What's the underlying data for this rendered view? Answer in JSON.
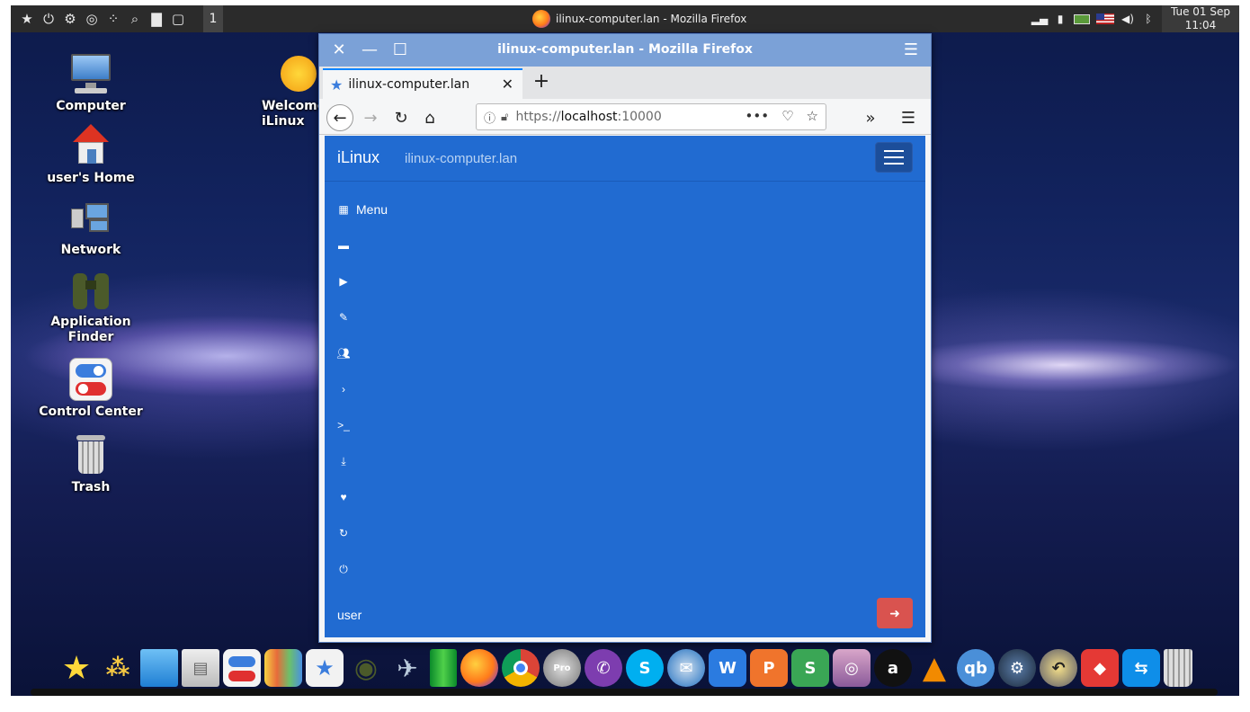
{
  "top_panel": {
    "workspace": "1",
    "task_title": "ilinux-computer.lan - Mozilla Firefox",
    "clock_date": "Tue 01 Sep",
    "clock_time": "11:04",
    "icons": [
      "favorites-star-icon",
      "power-icon",
      "settings-icon",
      "binoculars-icon",
      "apps-grid-icon",
      "search-icon",
      "folder-icon",
      "show-desktop-icon"
    ],
    "tray_icons": [
      "signal-icon",
      "clipboard-icon",
      "battery-icon",
      "flag-icon",
      "volume-icon",
      "bluetooth-icon"
    ]
  },
  "desktop_icons": [
    {
      "label": "Computer"
    },
    {
      "label": "user's Home"
    },
    {
      "label": "Network"
    },
    {
      "label": "Application Finder"
    },
    {
      "label": "Control Center"
    },
    {
      "label": "Trash"
    },
    {
      "label": "Welcome iLinux"
    }
  ],
  "window": {
    "title": "ilinux-computer.lan - Mozilla Firefox",
    "tab_label": "ilinux-computer.lan",
    "url_scheme": "https://",
    "url_host": "localhost",
    "url_port": ":10000"
  },
  "page": {
    "brand": "iLinux",
    "hostname": "ilinux-computer.lan",
    "menu_label": "Menu",
    "user": "user",
    "menu_icons": [
      "folder-icon",
      "play-icon",
      "pencil-icon",
      "users-icon",
      "chevron-right-icon",
      "terminal-icon",
      "download-icon",
      "heartbeat-icon",
      "refresh-icon",
      "power-icon"
    ]
  },
  "dock": {
    "apps": [
      "favorites",
      "apps",
      "window",
      "file-cabinet",
      "control-center",
      "appearance",
      "store",
      "binoculars",
      "rocket",
      "pipe",
      "firefox",
      "chrome",
      "globe-pro",
      "viber",
      "skype",
      "thunderbird",
      "writer",
      "presentation",
      "spreadsheet",
      "camera",
      "audacity",
      "vlc",
      "qbittorrent",
      "steam",
      "backup",
      "anydesk",
      "teamviewer",
      "trash"
    ]
  }
}
